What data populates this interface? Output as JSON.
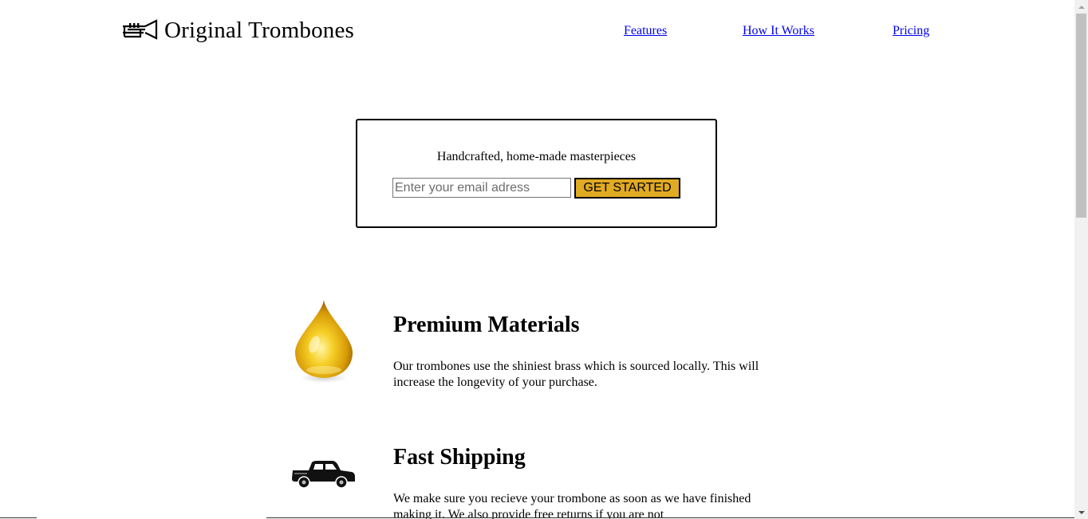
{
  "header": {
    "brand": "Original Trombones",
    "logo_icon": "trombone-icon",
    "nav": [
      {
        "label": "Features"
      },
      {
        "label": "How It Works"
      },
      {
        "label": "Pricing"
      }
    ]
  },
  "hero": {
    "tagline": "Handcrafted, home-made masterpieces",
    "email_placeholder": "Enter your email adress",
    "email_value": "",
    "cta_label": "GET STARTED"
  },
  "features": [
    {
      "icon": "oil-drop-icon",
      "title": "Premium Materials",
      "text": "Our trombones use the shiniest brass which is sourced locally. This will increase the longevity of your purchase."
    },
    {
      "icon": "truck-icon",
      "title": "Fast Shipping",
      "text": "We make sure you recieve your trombone as soon as we have finished making it. We also provide free returns if you are not"
    }
  ],
  "colors": {
    "accent": "#e0aa23",
    "link": "#0000ee",
    "text": "#000000"
  }
}
